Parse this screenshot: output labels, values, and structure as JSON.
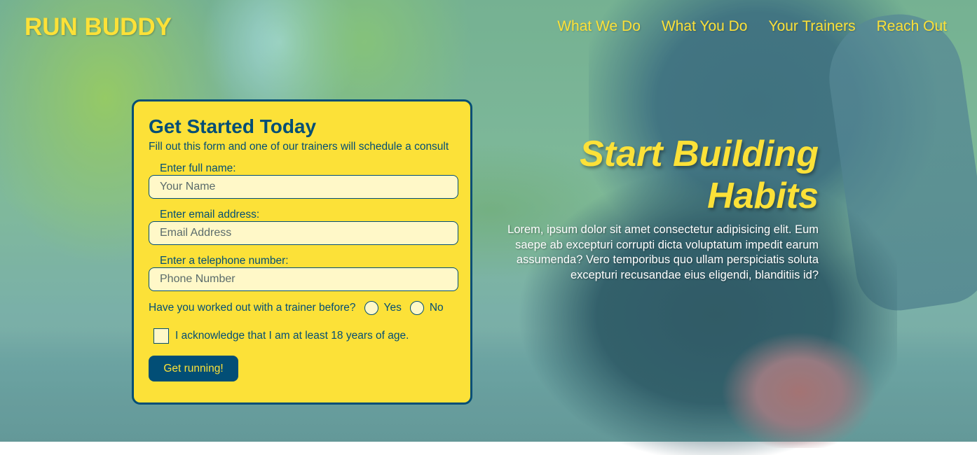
{
  "header": {
    "brand": "RUN BUDDY",
    "nav": [
      "What We Do",
      "What You Do",
      "Your Trainers",
      "Reach Out"
    ]
  },
  "form": {
    "title": "Get Started Today",
    "subtitle": "Fill out this form and one of our trainers will schedule a consult",
    "fields": [
      {
        "label": "Enter full name:",
        "placeholder": "Your Name",
        "value": ""
      },
      {
        "label": "Enter email address:",
        "placeholder": "Email Address",
        "value": ""
      },
      {
        "label": "Enter a telephone number:",
        "placeholder": "Phone Number",
        "value": ""
      }
    ],
    "trainer_question": "Have you worked out with a trainer before?",
    "radio_yes": "Yes",
    "radio_no": "No",
    "age_ack": "I acknowledge that I am at least 18 years of age.",
    "submit": "Get running!"
  },
  "hero": {
    "title_line1": "Start Building",
    "title_line2": "Habits",
    "body": "Lorem, ipsum dolor sit amet consectetur adipisicing elit. Eum saepe ab excepturi corrupti dicta voluptatum impedit earum assumenda? Vero temporibus quo ullam perspiciatis soluta excepturi recusandae eius eligendi, blanditiis id?"
  },
  "colors": {
    "accent": "#fce138",
    "primary": "#024e76"
  }
}
